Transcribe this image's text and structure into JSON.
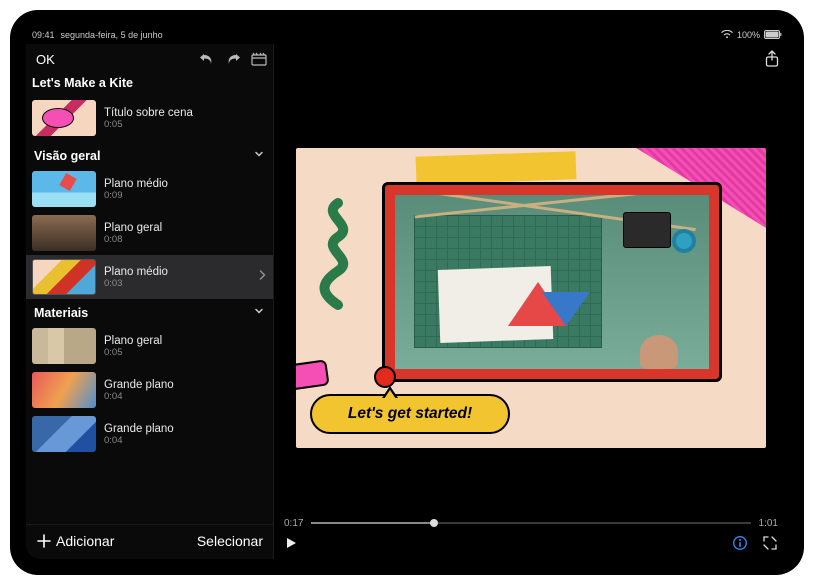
{
  "status": {
    "time": "09:41",
    "date": "segunda-feira, 5 de junho",
    "battery_pct": "100%"
  },
  "toolbar": {
    "ok": "OK"
  },
  "project": {
    "title": "Let's Make a Kite"
  },
  "intro_clip": {
    "label": "Título sobre cena",
    "duration": "0:05"
  },
  "sections": [
    {
      "title": "Visão geral",
      "clips": [
        {
          "label": "Plano médio",
          "duration": "0:09",
          "thumb": "t-kite",
          "selected": false
        },
        {
          "label": "Plano geral",
          "duration": "0:08",
          "thumb": "t-person",
          "selected": false
        },
        {
          "label": "Plano médio",
          "duration": "0:03",
          "thumb": "t-sel",
          "selected": true
        }
      ]
    },
    {
      "title": "Materiais",
      "clips": [
        {
          "label": "Plano geral",
          "duration": "0:05",
          "thumb": "t-mat1",
          "selected": false
        },
        {
          "label": "Grande plano",
          "duration": "0:04",
          "thumb": "t-mat2",
          "selected": false
        },
        {
          "label": "Grande plano",
          "duration": "0:04",
          "thumb": "t-mat3",
          "selected": false
        }
      ]
    }
  ],
  "bottom": {
    "add": "Adicionar",
    "select": "Selecionar"
  },
  "preview": {
    "bubble_text": "Let's get started!"
  },
  "transport": {
    "current": "0:17",
    "total": "1:01"
  }
}
